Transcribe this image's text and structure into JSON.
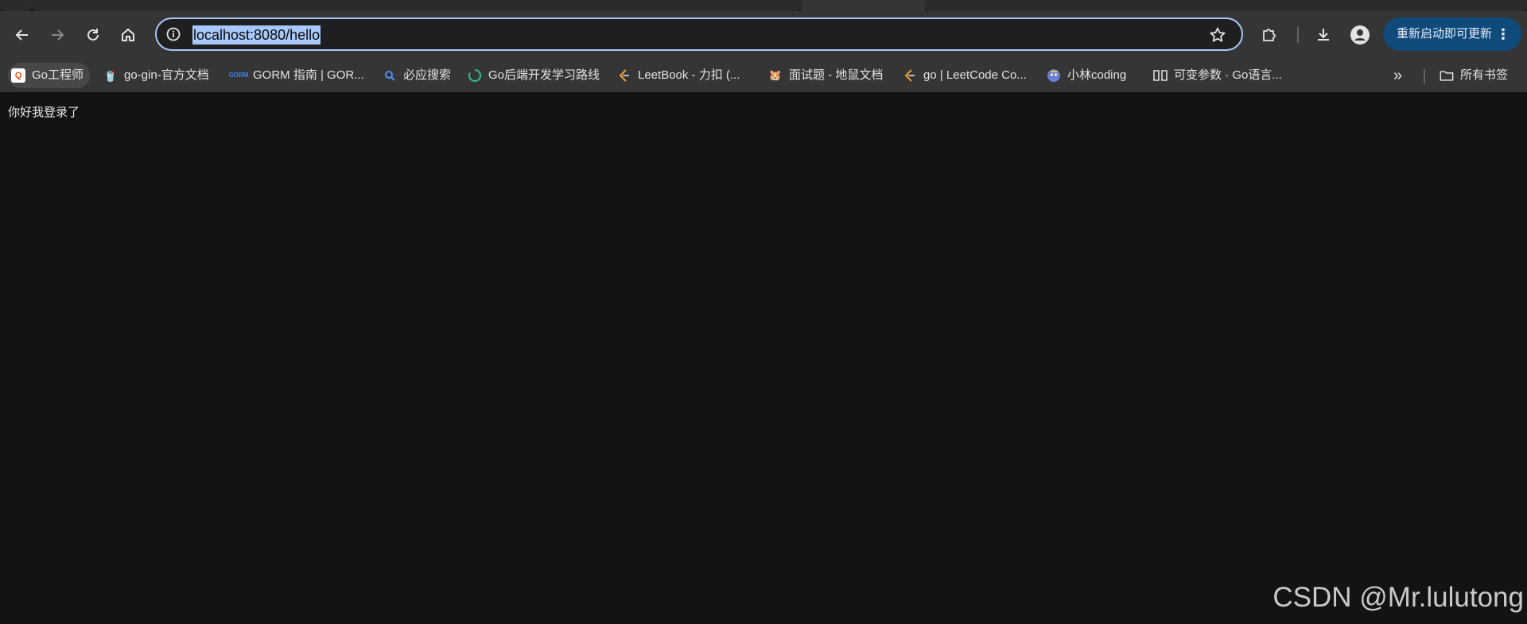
{
  "toolbar": {
    "url": "localhost:8080/hello",
    "update_label": "重新启动即可更新"
  },
  "bookmarks": [
    {
      "label": "Go工程师",
      "icon": "go-engineer-icon"
    },
    {
      "label": "go-gin-官方文档",
      "icon": "gin-icon"
    },
    {
      "label": "GORM 指南 | GOR...",
      "icon": "gorm-icon"
    },
    {
      "label": "必应搜索",
      "icon": "search-icon"
    },
    {
      "label": "Go后端开发学习路线",
      "icon": "spinner-icon"
    },
    {
      "label": "LeetBook - 力扣 (...",
      "icon": "leetcode-icon"
    },
    {
      "label": "面试题 - 地鼠文档",
      "icon": "gopher-icon"
    },
    {
      "label": "go | LeetCode Co...",
      "icon": "leetcode-icon"
    },
    {
      "label": "小林coding",
      "icon": "xiaolin-icon"
    },
    {
      "label": "可变参数 · Go语言...",
      "icon": "book-icon"
    }
  ],
  "all_bookmarks_label": "所有书签",
  "page": {
    "text": "你好我登录了"
  },
  "watermark": "CSDN @Mr.lulutong",
  "colors": {
    "omnibox_border": "#a8c7fa",
    "update_button": "#0f4a7a",
    "page_bg": "#131313",
    "chrome_bg": "#353535"
  }
}
